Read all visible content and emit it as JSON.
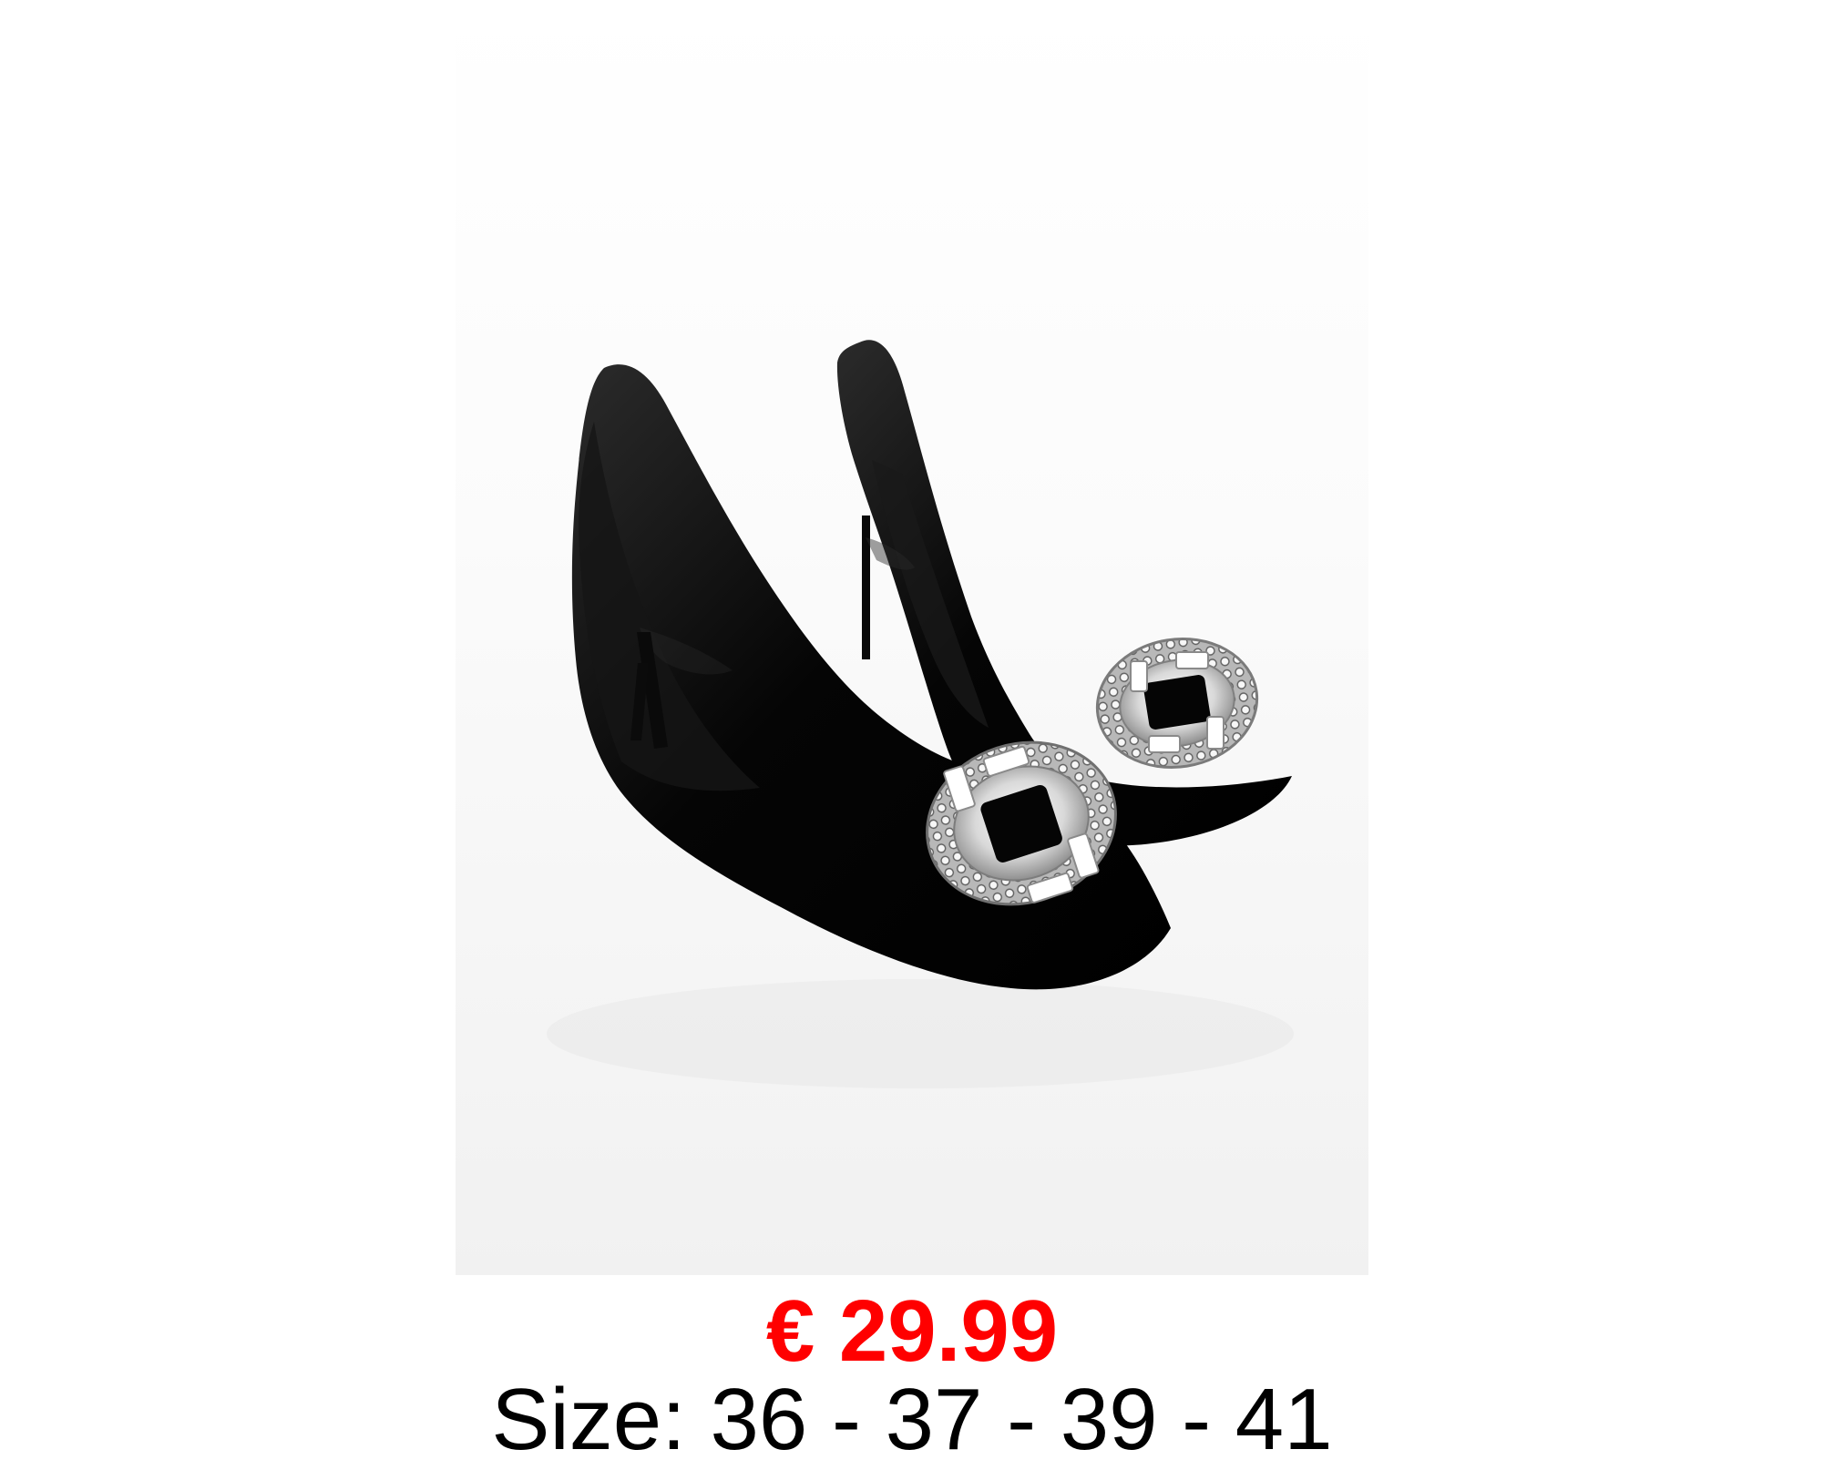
{
  "product": {
    "image_subject": "black-pointed-toe-stiletto-pumps-with-crystal-buckle",
    "price": "€ 29.99",
    "sizes": "Size: 36 - 37 - 39 - 41",
    "price_color": "#ff0000",
    "text_color": "#000000",
    "background_color": "#ffffff"
  }
}
